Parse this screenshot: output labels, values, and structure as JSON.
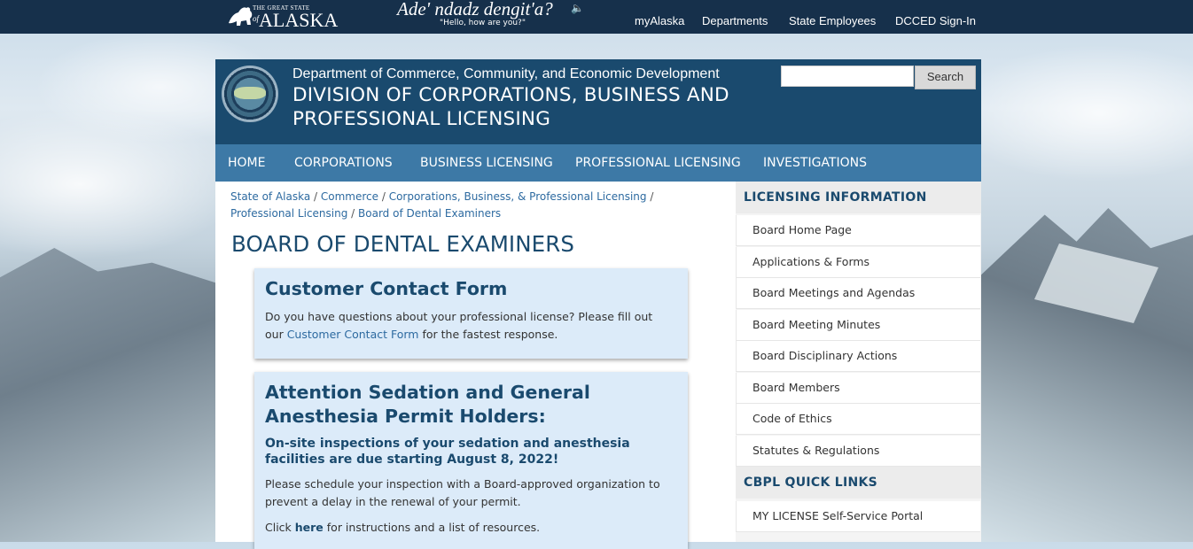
{
  "topbar": {
    "logo_small": "THE GREAT STATE",
    "logo_of": "of",
    "logo_main": "ALASKA",
    "greeting": "Ade' ndadz dengit'a?",
    "greeting_translation": "\"Hello, how are you?\"",
    "links": [
      "myAlaska",
      "Departments",
      "State Employees",
      "DCCED Sign-In"
    ]
  },
  "header": {
    "department": "Department of Commerce, Community, and Economic Development",
    "division": "DIVISION OF CORPORATIONS, BUSINESS AND PROFESSIONAL LICENSING",
    "search_value": "",
    "search_button": "Search"
  },
  "nav": [
    "HOME",
    "CORPORATIONS",
    "BUSINESS LICENSING",
    "PROFESSIONAL LICENSING",
    "INVESTIGATIONS"
  ],
  "breadcrumb": [
    "State of Alaska",
    "Commerce",
    "Corporations, Business, & Professional Licensing",
    "Professional Licensing",
    "Board of Dental Examiners"
  ],
  "page_title": "BOARD OF DENTAL EXAMINERS",
  "contact_card": {
    "title": "Customer Contact Form",
    "text_before": "Do you have questions about your professional license? Please fill out our ",
    "link": "Customer Contact Form",
    "text_after": " for the fastest response."
  },
  "sedation_card": {
    "title": "Attention Sedation and General Anesthesia Permit Holders:",
    "subtitle": "On-site inspections of your sedation and anesthesia facilities are due starting August 8, 2022!",
    "para1": "Please schedule your inspection with a Board-approved organization to prevent a delay in the renewal of your permit.",
    "para2_before": "Click ",
    "para2_link": "here",
    "para2_after": " for instructions and a list of resources."
  },
  "sidebar": {
    "licensing_heading": "LICENSING INFORMATION",
    "licensing_items": [
      "Board Home Page",
      "Applications & Forms",
      "Board Meetings and Agendas",
      "Board Meeting Minutes",
      "Board Disciplinary Actions",
      "Board Members",
      "Code of Ethics",
      "Statutes & Regulations"
    ],
    "quick_heading": "CBPL QUICK LINKS",
    "quick_items": [
      "MY LICENSE Self-Service Portal"
    ]
  }
}
